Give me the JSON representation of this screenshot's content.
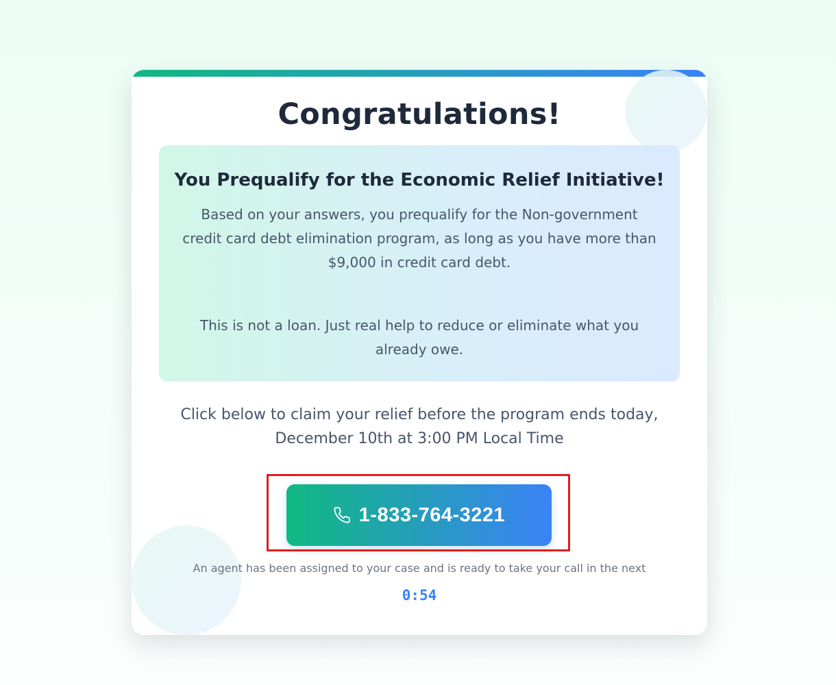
{
  "card": {
    "headline": "Congratulations!",
    "info_box": {
      "title": "You Prequalify for the Economic Relief Initiative!",
      "body": "Based on your answers, you prequalify for the Non-government credit card debt elimination program, as long as you have more than $9,000 in credit card debt.",
      "note": "This is not a loan. Just real help to reduce or eliminate what you already owe."
    },
    "claim_text": "Click below to claim your relief before the program ends today, December 10th at 3:00 PM Local Time",
    "call_button": {
      "icon": "phone-icon",
      "number": "1-833-764-3221"
    },
    "agent_text": "An agent has been assigned to your case and is ready to take your call in the next",
    "timer": "0:54"
  },
  "colors": {
    "accent_green": "#10b981",
    "accent_blue": "#3b82f6",
    "highlight_red": "#e11d1d",
    "heading": "#1e293b",
    "body_text": "#475569"
  }
}
